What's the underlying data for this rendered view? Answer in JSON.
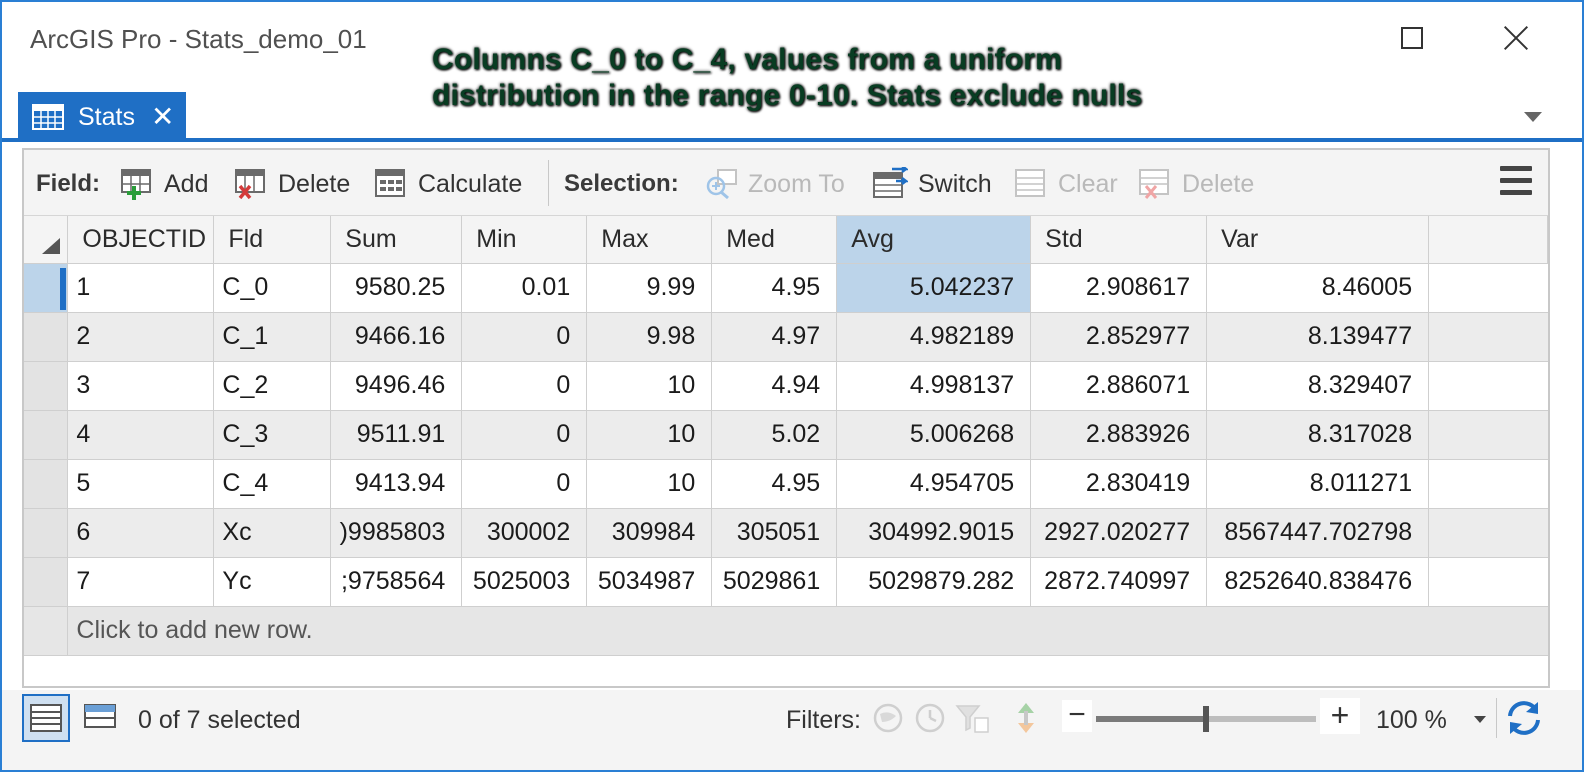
{
  "window": {
    "title": "ArcGIS Pro - Stats_demo_01"
  },
  "annotation": {
    "line1": "Columns C_0 to C_4, values from a uniform",
    "line2": "distribution in the range 0-10.  Stats exclude nulls"
  },
  "tab": {
    "label": "Stats",
    "close": "✕"
  },
  "toolbar": {
    "field_label": "Field:",
    "add_label": "Add",
    "delete_label": "Delete",
    "calculate_label": "Calculate",
    "selection_label": "Selection:",
    "zoom_to_label": "Zoom To",
    "switch_label": "Switch",
    "clear_label": "Clear",
    "sel_delete_label": "Delete"
  },
  "table": {
    "columns": [
      "OBJECTID",
      "Fld",
      "Sum",
      "Min",
      "Max",
      "Med",
      "Avg",
      "Std",
      "Var"
    ],
    "selected_column": "Avg",
    "rows": [
      [
        "1",
        "C_0",
        "9580.25",
        "0.01",
        "9.99",
        "4.95",
        "5.042237",
        "2.908617",
        "8.46005"
      ],
      [
        "2",
        "C_1",
        "9466.16",
        "0",
        "9.98",
        "4.97",
        "4.982189",
        "2.852977",
        "8.139477"
      ],
      [
        "3",
        "C_2",
        "9496.46",
        "0",
        "10",
        "4.94",
        "4.998137",
        "2.886071",
        "8.329407"
      ],
      [
        "4",
        "C_3",
        "9511.91",
        "0",
        "10",
        "5.02",
        "5.006268",
        "2.883926",
        "8.317028"
      ],
      [
        "5",
        "C_4",
        "9413.94",
        "0",
        "10",
        "4.95",
        "4.954705",
        "2.830419",
        "8.011271"
      ],
      [
        "6",
        "Xc",
        ")9985803",
        "300002",
        "309984",
        "305051",
        "304992.9015",
        "2927.020277",
        "8567447.702798"
      ],
      [
        "7",
        "Yc",
        ";9758564",
        "5025003",
        "5034987",
        "5029861",
        "5029879.282",
        "2872.740997",
        "8252640.838476"
      ]
    ],
    "new_row_text": "Click to add new row."
  },
  "status": {
    "selected_text": "0 of 7 selected",
    "filters_label": "Filters:",
    "zoom_minus": "−",
    "zoom_plus": "+",
    "zoom_level": "100 %",
    "zoom_fraction": 0.5
  },
  "colors": {
    "accent": "#1f6fc5",
    "selected_cell": "#bcd4ea",
    "annotation_text": "#083c22"
  }
}
